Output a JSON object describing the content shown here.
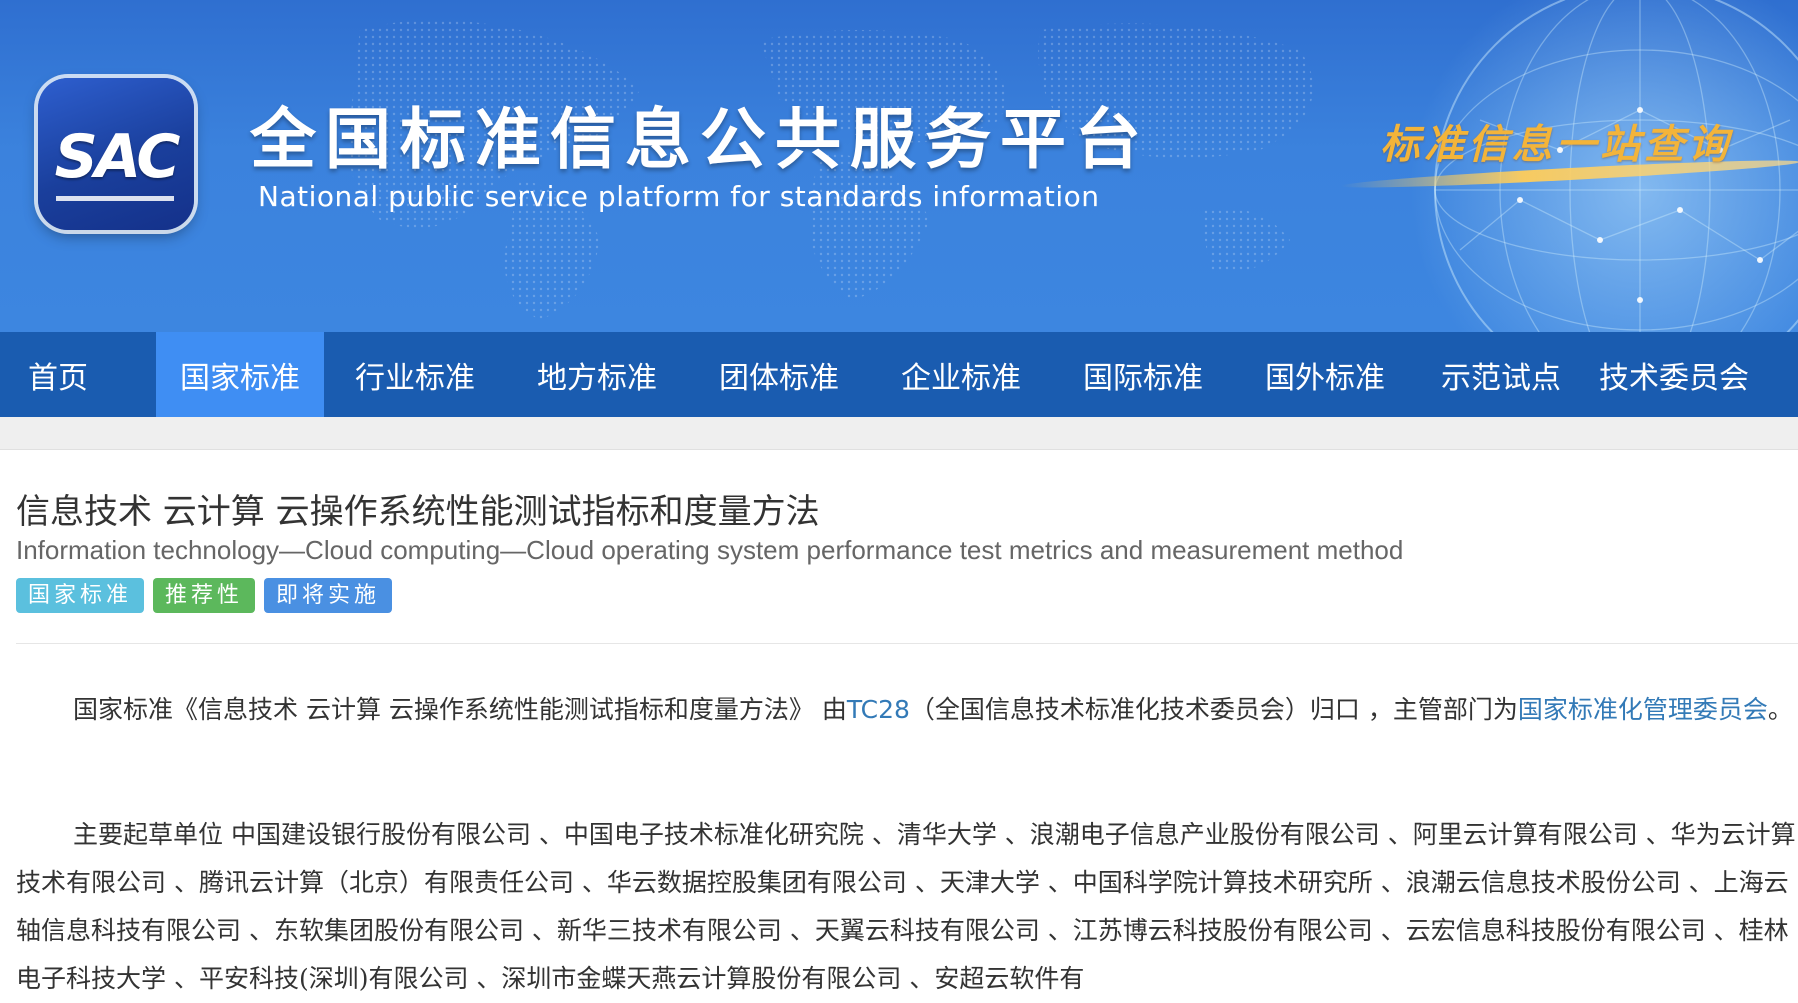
{
  "header": {
    "logo_text": "SAC",
    "site_title": "全国标准信息公共服务平台",
    "site_subtitle": "National public service platform  for standards information",
    "slogan": "标准信息一站查询"
  },
  "nav": {
    "items": [
      {
        "label": "首页"
      },
      {
        "label": "国家标准"
      },
      {
        "label": "行业标准"
      },
      {
        "label": "地方标准"
      },
      {
        "label": "团体标准"
      },
      {
        "label": "企业标准"
      },
      {
        "label": "国际标准"
      },
      {
        "label": "国外标准"
      },
      {
        "label": "示范试点"
      },
      {
        "label": "技术委员会"
      }
    ],
    "active": "国家标准"
  },
  "standard": {
    "title": "信息技术 云计算 云操作系统性能测试指标和度量方法",
    "title_en": "Information technology—Cloud computing—Cloud operating system performance test metrics and measurement method",
    "badges": [
      "国家标准",
      "推荐性",
      "即将实施"
    ]
  },
  "description": {
    "p1_prefix": "国家标准《信息技术 云计算 云操作系统性能测试指标和度量方法》 由",
    "p1_tc_link": "TC28",
    "p1_middle": "（全国信息技术标准化技术委员会）归口 ，主管部门为",
    "p1_dept_link": "国家标准化管理委员会",
    "p1_suffix": "。",
    "p2_text": "主要起草单位 中国建设银行股份有限公司 、中国电子技术标准化研究院 、清华大学 、浪潮电子信息产业股份有限公司 、阿里云计算有限公司 、华为云计算技术有限公司 、腾讯云计算（北京）有限责任公司 、华云数据控股集团有限公司 、天津大学 、中国科学院计算技术研究所 、浪潮云信息技术股份公司 、上海云轴信息科技有限公司 、东软集团股份有限公司 、新华三技术有限公司 、天翼云科技有限公司 、江苏博云科技股份有限公司 、云宏信息科技股份有限公司 、桂林电子科技大学 、平安科技(深圳)有限公司 、深圳市金蝶天燕云计算股份有限公司 、安超云软件有"
  },
  "colors": {
    "banner_blue": "#3b82dd",
    "nav_bg": "#1a5cb0",
    "nav_active": "#3f8ef3",
    "slogan_gold": "#f3b43a",
    "link_blue": "#337ab7",
    "badge_national": "#5bc0de",
    "badge_recommended": "#5cb85c",
    "badge_upcoming": "#4a90e2"
  }
}
